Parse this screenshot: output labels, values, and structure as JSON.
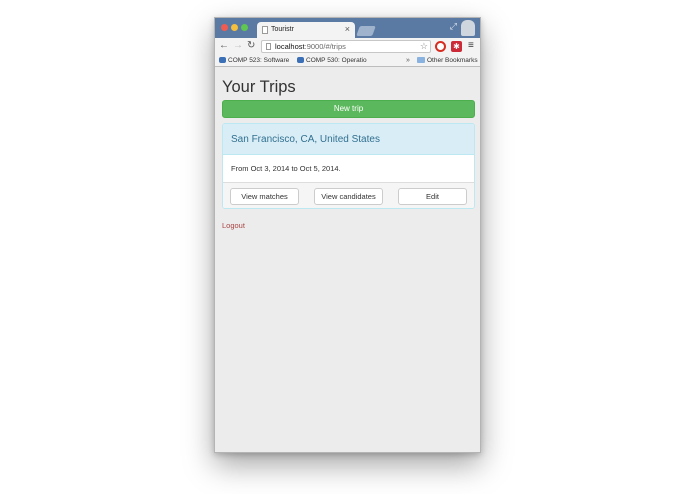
{
  "browser": {
    "tab": {
      "title": "Touristr",
      "close": "×"
    },
    "address": {
      "host": "localhost",
      "rest": ":9000/#/trips"
    },
    "bookmarks": [
      {
        "label": "COMP 523: Software"
      },
      {
        "label": "COMP 530: Operatio"
      }
    ],
    "bookmarks_overflow": "»",
    "other_bookmarks": "Other Bookmarks"
  },
  "page": {
    "title": "Your Trips",
    "new_trip_label": "New trip",
    "trip": {
      "destination": "San Francisco, CA, United States",
      "dates": "From Oct 3, 2014 to Oct 5, 2014.",
      "actions": {
        "view_matches": "View matches",
        "view_candidates": "View candidates",
        "edit": "Edit"
      }
    },
    "logout_label": "Logout"
  },
  "colors": {
    "success": "#5cb85c",
    "info_bg": "#d9edf7",
    "info_text": "#31708f",
    "danger_text": "#a94442",
    "titlebar": "#5b7aa3"
  }
}
